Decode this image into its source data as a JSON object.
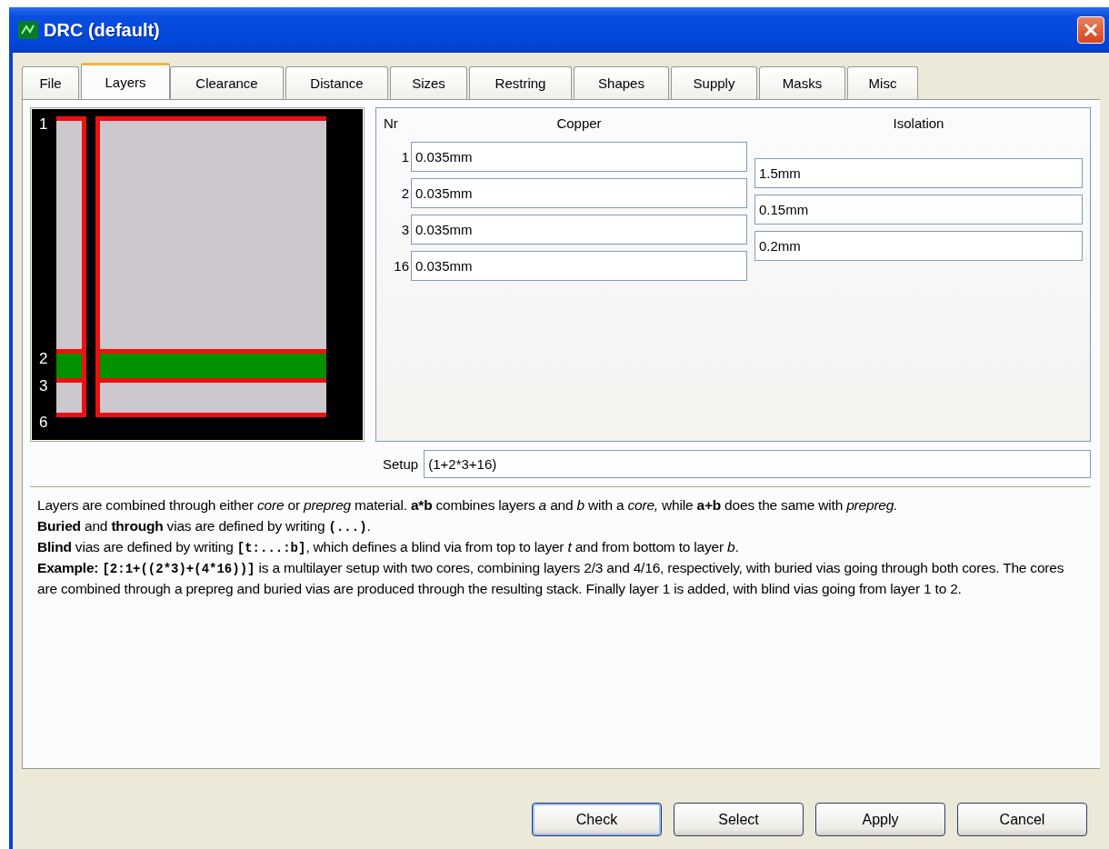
{
  "window": {
    "title": "DRC (default)"
  },
  "tabs": [
    {
      "label": "File",
      "selected": false
    },
    {
      "label": "Layers",
      "selected": true
    },
    {
      "label": "Clearance",
      "selected": false
    },
    {
      "label": "Distance",
      "selected": false
    },
    {
      "label": "Sizes",
      "selected": false
    },
    {
      "label": "Restring",
      "selected": false
    },
    {
      "label": "Shapes",
      "selected": false
    },
    {
      "label": "Supply",
      "selected": false
    },
    {
      "label": "Masks",
      "selected": false
    },
    {
      "label": "Misc",
      "selected": false
    }
  ],
  "diagram": {
    "layer_labels": [
      "1",
      "2",
      "3",
      "6"
    ]
  },
  "layer_table": {
    "columns": [
      "Nr",
      "Copper",
      "Isolation"
    ],
    "copper": [
      {
        "nr": "1",
        "value": "0.035mm"
      },
      {
        "nr": "2",
        "value": "0.035mm"
      },
      {
        "nr": "3",
        "value": "0.035mm"
      },
      {
        "nr": "16",
        "value": "0.035mm"
      }
    ],
    "isolation": [
      "1.5mm",
      "0.15mm",
      "0.2mm"
    ]
  },
  "setup": {
    "label": "Setup",
    "value": "(1+2*3+16)"
  },
  "help": [
    [
      {
        "kind": "text",
        "text": "Layers are combined through either *core* or *prepreg* material. **a*b** combines layers *a* and *b* with a *core,* while **a+b** does the same with *prepreg.*"
      }
    ],
    [
      {
        "kind": "text",
        "text": "**Buried** and **through** vias are defined by writing "
      },
      {
        "kind": "code",
        "text": "(...)"
      },
      {
        "kind": "text",
        "text": "."
      }
    ],
    [
      {
        "kind": "text",
        "text": "**Blind** vias are defined by writing "
      },
      {
        "kind": "code",
        "text": "[t:...:b]"
      },
      {
        "kind": "text",
        "text": ", which defines a blind via from top to layer *t* and from bottom to layer *b*."
      }
    ],
    [
      {
        "kind": "text",
        "text": "**Example:** "
      },
      {
        "kind": "code",
        "text": "[2:1+((2*3)+(4*16))]"
      },
      {
        "kind": "text",
        "text": " is a multilayer setup with two cores, combining layers 2/3 and 4/16, respectively, with buried vias going through both cores. The cores are combined through a prepreg and buried vias are produced through the resulting stack. Finally layer 1 is added, with blind vias going from layer 1 to 2."
      }
    ]
  ],
  "buttons": [
    {
      "label": "Check",
      "default": true
    },
    {
      "label": "Select",
      "default": false
    },
    {
      "label": "Apply",
      "default": false
    },
    {
      "label": "Cancel",
      "default": false
    }
  ]
}
